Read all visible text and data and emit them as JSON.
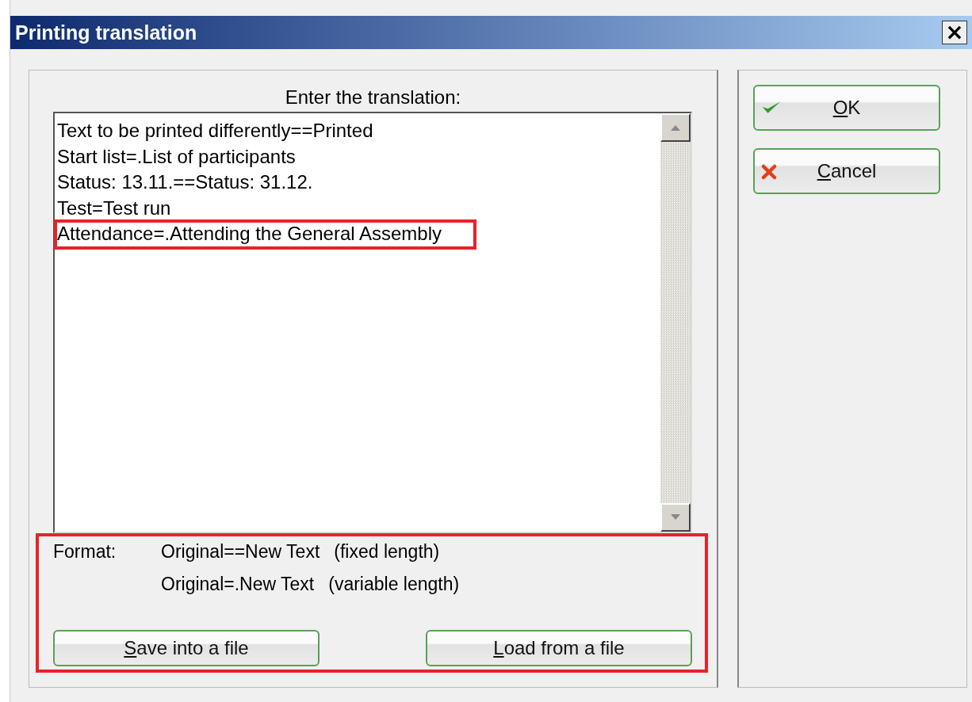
{
  "window": {
    "title": "Printing translation",
    "close": "×"
  },
  "editor": {
    "label": "Enter the translation:",
    "lines": [
      {
        "text": "Text to be printed differently==Printed",
        "highlighted": false
      },
      {
        "text": "Start list=.List of participants",
        "highlighted": false
      },
      {
        "text": "Status: 13.11.==Status: 31.12.",
        "highlighted": false
      },
      {
        "text": "Test=Test run",
        "highlighted": false
      },
      {
        "text": "Attendance=.Attending the General Assembly",
        "highlighted": true
      }
    ]
  },
  "format": {
    "highlighted": true,
    "label": "Format:",
    "examples": [
      {
        "pattern": "Original==New Text",
        "note": "(fixed length)"
      },
      {
        "pattern": "Original=.New Text",
        "note": "(variable length)"
      }
    ],
    "buttons": [
      "Save into a file",
      "Load from a file"
    ]
  },
  "actions": [
    {
      "kind": "ok",
      "label": "OK"
    },
    {
      "kind": "cancel",
      "label": "Cancel"
    }
  ]
}
